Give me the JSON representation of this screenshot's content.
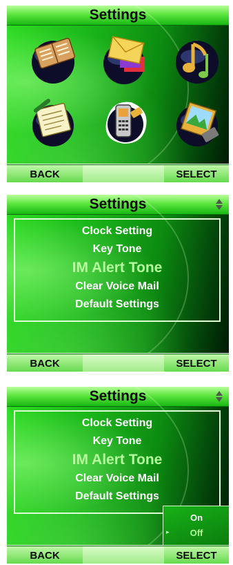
{
  "screens": [
    {
      "title": "Settings",
      "icons": [
        {
          "name": "address-book-icon"
        },
        {
          "name": "messages-icon"
        },
        {
          "name": "music-icon"
        },
        {
          "name": "notepad-icon"
        },
        {
          "name": "phone-settings-icon"
        },
        {
          "name": "pictures-icon"
        }
      ],
      "softkeys": {
        "left": "BACK",
        "right": "SELECT"
      }
    },
    {
      "title": "Settings",
      "menu_items": [
        "Clock Setting",
        "Key Tone",
        "IM Alert Tone",
        "Clear Voice Mail",
        "Default Settings"
      ],
      "selected_index": 2,
      "softkeys": {
        "left": "BACK",
        "right": "SELECT"
      }
    },
    {
      "title": "Settings",
      "menu_items": [
        "Clock Setting",
        "Key Tone",
        "IM Alert Tone",
        "Clear Voice Mail",
        "Default Settings"
      ],
      "selected_index": 2,
      "popup_options": [
        "On",
        "Off"
      ],
      "popup_selected_index": 1,
      "softkeys": {
        "left": "BACK",
        "right": "SELECT"
      }
    }
  ],
  "colors": {
    "accent": "#2edc22",
    "highlight_text": "#b4ff9e"
  }
}
